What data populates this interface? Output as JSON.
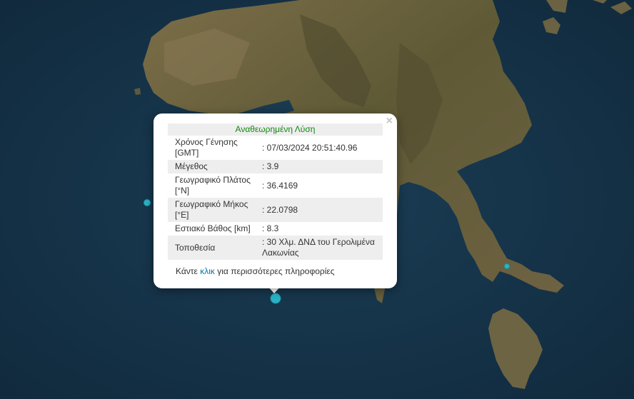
{
  "popup": {
    "title": "Αναθεωρημένη Λύση",
    "close": "×",
    "rows": [
      {
        "label": "Χρόνος Γένησης [GMT]",
        "value": ": 07/03/2024 20:51:40.96"
      },
      {
        "label": "Μέγεθος",
        "value": ": 3.9"
      },
      {
        "label": "Γεωγραφικό Πλάτος [°N]",
        "value": ": 36.4169"
      },
      {
        "label": "Γεωγραφικό Μήκος [°E]",
        "value": ": 22.0798"
      },
      {
        "label": "Εστιακό Βάθος [km]",
        "value": ": 8.3"
      },
      {
        "label": "Τοποθεσία",
        "value": ": 30 Χλμ. ΔΝΔ του Γερολιμένα Λακωνίας"
      }
    ],
    "more_prefix": "Κάντε",
    "more_link": "κλικ",
    "more_suffix": "για περισσότερες πληροφορίες"
  },
  "colors": {
    "sea": "#15334a",
    "land": "#6b6040",
    "marker": "#2ab3c8"
  }
}
